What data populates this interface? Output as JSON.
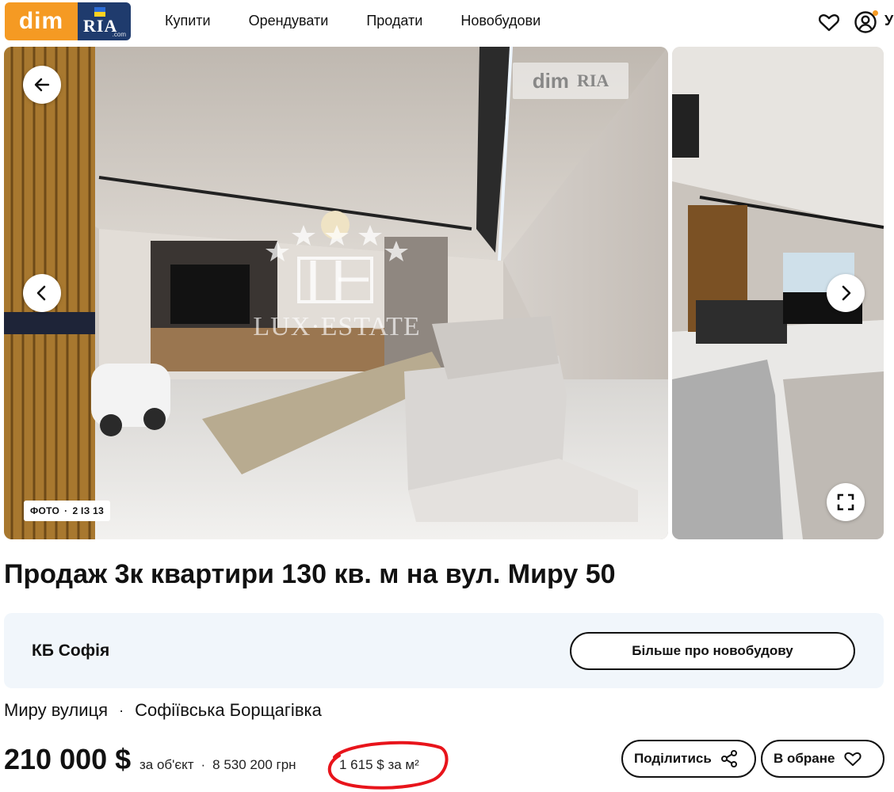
{
  "header": {
    "logo_dim": "dim",
    "logo_ria": "RIA",
    "logo_com": ".com",
    "nav": [
      "Купити",
      "Орендувати",
      "Продати",
      "Новобудови"
    ],
    "user_letter": "У",
    "accent": "#f59a23",
    "brand_blue": "#1f3b6d"
  },
  "gallery": {
    "counter_label": "ФОТО",
    "counter_sep": "·",
    "counter_value": "2 ІЗ 13",
    "watermark_dim": "dim",
    "watermark_ria": "RIA",
    "lux_watermark": "LUX·ESTATE"
  },
  "listing": {
    "title": "Продаж 3к квартири 130 кв. м на вул. Миру 50",
    "complex_name": "КБ Софія",
    "complex_button": "Більше про новобудову",
    "street": "Миру вулиця",
    "address_sep": "·",
    "district": "Софіївська Борщагівка",
    "price": "210 000 $",
    "price_unit": "за об'єкт",
    "price_sep": "·",
    "price_uah": "8 530 200 грн",
    "price_per_m2": "1 615 $ за м²",
    "share_button": "Поділитись",
    "favorite_button": "В обране",
    "highlight_color": "#e8141b"
  }
}
